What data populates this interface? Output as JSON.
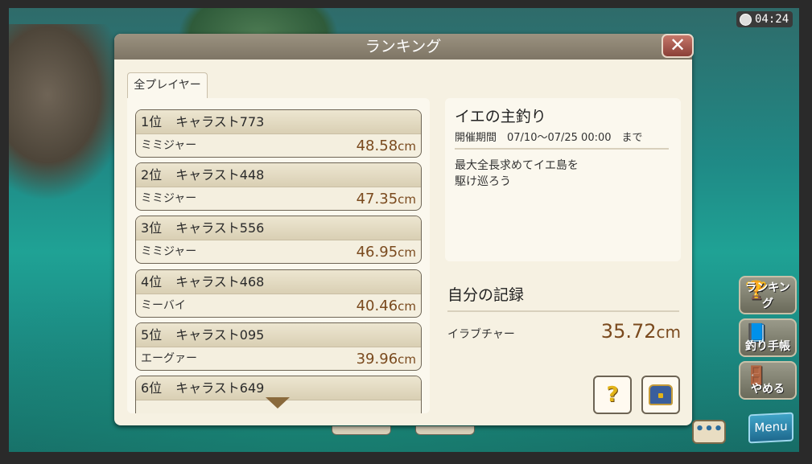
{
  "clock": {
    "time": "04:24"
  },
  "dialog": {
    "title": "ランキング",
    "close_label": "✕",
    "tab_label": "全プレイヤー"
  },
  "ranking": [
    {
      "place": "1位",
      "player": "キャラスト773",
      "fish": "ミミジャー",
      "size": "48.58",
      "unit": "cm"
    },
    {
      "place": "2位",
      "player": "キャラスト448",
      "fish": "ミミジャー",
      "size": "47.35",
      "unit": "cm"
    },
    {
      "place": "3位",
      "player": "キャラスト556",
      "fish": "ミミジャー",
      "size": "46.95",
      "unit": "cm"
    },
    {
      "place": "4位",
      "player": "キャラスト468",
      "fish": "ミーバイ",
      "size": "40.46",
      "unit": "cm"
    },
    {
      "place": "5位",
      "player": "キャラスト095",
      "fish": "エーグァー",
      "size": "39.96",
      "unit": "cm"
    },
    {
      "place": "6位",
      "player": "キャラスト649",
      "fish": "",
      "size": "",
      "unit": ""
    }
  ],
  "event": {
    "title": "イエの主釣り",
    "period": "開催期間　07/10〜07/25 00:00　まで",
    "desc_line1": "最大全長求めてイエ島を",
    "desc_line2": "駆け巡ろう"
  },
  "record": {
    "title": "自分の記録",
    "fish": "イラブチャー",
    "size": "35.72",
    "unit": "cm"
  },
  "side_buttons": {
    "ranking": "ランキング",
    "notebook": "釣り手帳",
    "quit": "やめる",
    "menu": "Menu",
    "chat": "•••"
  },
  "colors": {
    "size_text": "#7a4a1e",
    "header": "#8d8472",
    "close_button": "#a85a50",
    "panel": "#fbf8ee"
  }
}
